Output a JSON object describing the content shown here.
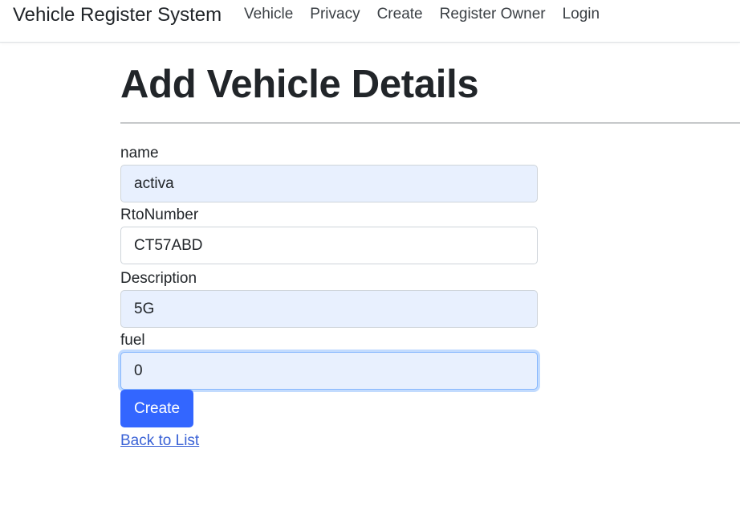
{
  "navbar": {
    "brand": "Vehicle Register System",
    "links": [
      {
        "label": "Vehicle"
      },
      {
        "label": "Privacy"
      },
      {
        "label": "Create"
      },
      {
        "label": "Register Owner"
      },
      {
        "label": "Login"
      }
    ]
  },
  "page": {
    "title": "Add Vehicle Details"
  },
  "form": {
    "fields": [
      {
        "label": "name",
        "value": "activa",
        "autofilled": true
      },
      {
        "label": "RtoNumber",
        "value": "CT57ABD",
        "autofilled": false
      },
      {
        "label": "Description",
        "value": "5G",
        "autofilled": true
      },
      {
        "label": "fuel",
        "value": "0",
        "autofilled": true,
        "focused": true
      }
    ],
    "submit_label": "Create",
    "back_link_label": "Back to List"
  },
  "colors": {
    "primary_button": "#3366ff",
    "link": "#3a62d6",
    "autofill_background": "#e8f0fe",
    "focus_ring": "#86b7fe"
  }
}
